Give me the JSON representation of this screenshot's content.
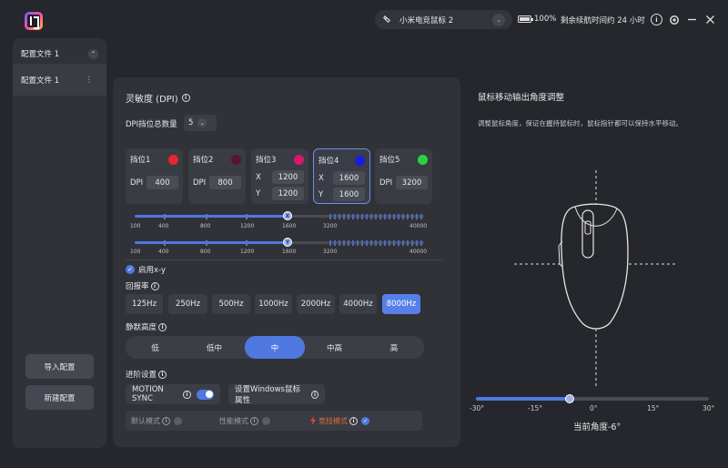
{
  "header": {
    "device_name": "小米电竞鼠标 2",
    "battery_percent": "100%",
    "battery_level": 1.0,
    "remaining_time": "剩余续航时间约 24 小时"
  },
  "sidebar": {
    "group_label": "配置文件 1",
    "items": [
      {
        "label": "配置文件 1"
      }
    ],
    "import_label": "导入配置",
    "new_label": "新建配置"
  },
  "dpi": {
    "title": "灵敏度 (DPI)",
    "count_label": "DPI挡位总数量",
    "count_value": "5",
    "slots": [
      {
        "label": "挡位1",
        "color": "#e8262e",
        "dpi_label": "DPI",
        "dpi": "400"
      },
      {
        "label": "挡位2",
        "color": "#5a1238",
        "dpi_label": "DPI",
        "dpi": "800"
      },
      {
        "label": "挡位3",
        "color": "#d8176c",
        "x_label": "X",
        "x": "1200",
        "y_label": "Y",
        "y": "1200"
      },
      {
        "label": "挡位4",
        "color": "#1a1ae0",
        "x_label": "X",
        "x": "1600",
        "y_label": "Y",
        "y": "1600"
      },
      {
        "label": "挡位5",
        "color": "#2bd240",
        "dpi_label": "DPI",
        "dpi": "3200"
      }
    ],
    "x_slider": {
      "knob_label": "X",
      "ticks": [
        "100",
        "400",
        "800",
        "1200",
        "1600",
        "3200",
        "40000"
      ]
    },
    "y_slider": {
      "knob_label": "Y",
      "ticks": [
        "100",
        "400",
        "800",
        "1200",
        "1600",
        "3200",
        "40000"
      ]
    },
    "enable_xy_label": "启用x-y"
  },
  "polling": {
    "label": "回报率",
    "rates": [
      "125Hz",
      "250Hz",
      "500Hz",
      "1000Hz",
      "2000Hz",
      "4000Hz",
      "8000Hz"
    ],
    "selected": "8000Hz"
  },
  "lod": {
    "label": "静默高度",
    "options": [
      "低",
      "低中",
      "中",
      "中高",
      "高"
    ],
    "selected": "中"
  },
  "advanced": {
    "label": "进阶设置",
    "motion_sync_label": "MOTION SYNC",
    "motion_sync_on": true,
    "windows_label": "设置Windows鼠标属性",
    "modes": [
      {
        "label": "默认模式",
        "active": false
      },
      {
        "label": "性能模式",
        "active": false
      },
      {
        "label": "竞技模式",
        "active": true
      }
    ]
  },
  "angle": {
    "title": "鼠标移动输出角度调整",
    "description": "调整鼠标角度，保证在握持鼠标时，鼠标指针都可以保持水平移动。",
    "min": -30,
    "max": 30,
    "value": -6,
    "tick_labels": [
      "-30°",
      "-15°",
      "0°",
      "15°",
      "30°"
    ],
    "current_label": "当前角度-6°"
  },
  "colors": {
    "accent": "#4f78e0",
    "panel": "#303238",
    "bg": "#25272c"
  }
}
